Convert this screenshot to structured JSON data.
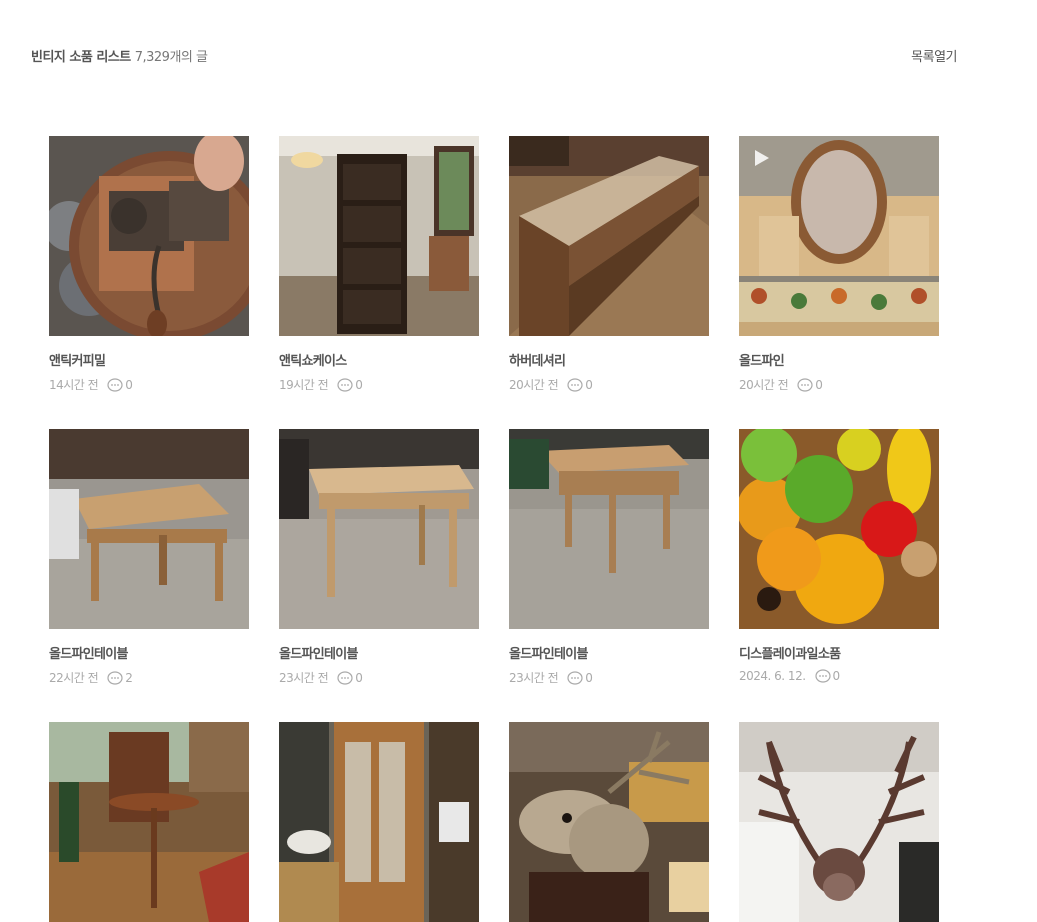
{
  "header": {
    "title": "빈티지 소품 리스트",
    "count": "7,329개의 글",
    "toggle_label": "목록열기"
  },
  "posts": [
    {
      "title": "앤틱커피밀",
      "time": "14시간 전",
      "comments": "0",
      "thumb": "coffee-mill-photo"
    },
    {
      "title": "앤틱쇼케이스",
      "time": "19시간 전",
      "comments": "0",
      "thumb": "bookcase-showcase-photo"
    },
    {
      "title": "하버데셔리",
      "time": "20시간 전",
      "comments": "0",
      "thumb": "glass-display-counter-photo"
    },
    {
      "title": "올드파인",
      "time": "20시간 전",
      "comments": "0",
      "thumb": "oval-mirror-pine-photo"
    },
    {
      "title": "올드파인테이블",
      "time": "22시간 전",
      "comments": "2",
      "thumb": "pine-table-photo"
    },
    {
      "title": "올드파인테이블",
      "time": "23시간 전",
      "comments": "0",
      "thumb": "pine-table-photo"
    },
    {
      "title": "올드파인테이블",
      "time": "23시간 전",
      "comments": "0",
      "thumb": "pine-table-photo"
    },
    {
      "title": "디스플레이과일소품",
      "time": "2024. 6. 12.",
      "comments": "0",
      "thumb": "display-fruit-photo"
    },
    {
      "thumb": "round-pedestal-table-photo"
    },
    {
      "thumb": "carved-glass-cabinet-photo"
    },
    {
      "thumb": "deer-head-mount-photo"
    },
    {
      "thumb": "antler-mount-photo"
    }
  ],
  "colors": {
    "text_primary": "#555555",
    "text_meta": "#aaaaaa",
    "background": "#ffffff"
  },
  "icons": {
    "comment": "comment-bubble-icon"
  }
}
